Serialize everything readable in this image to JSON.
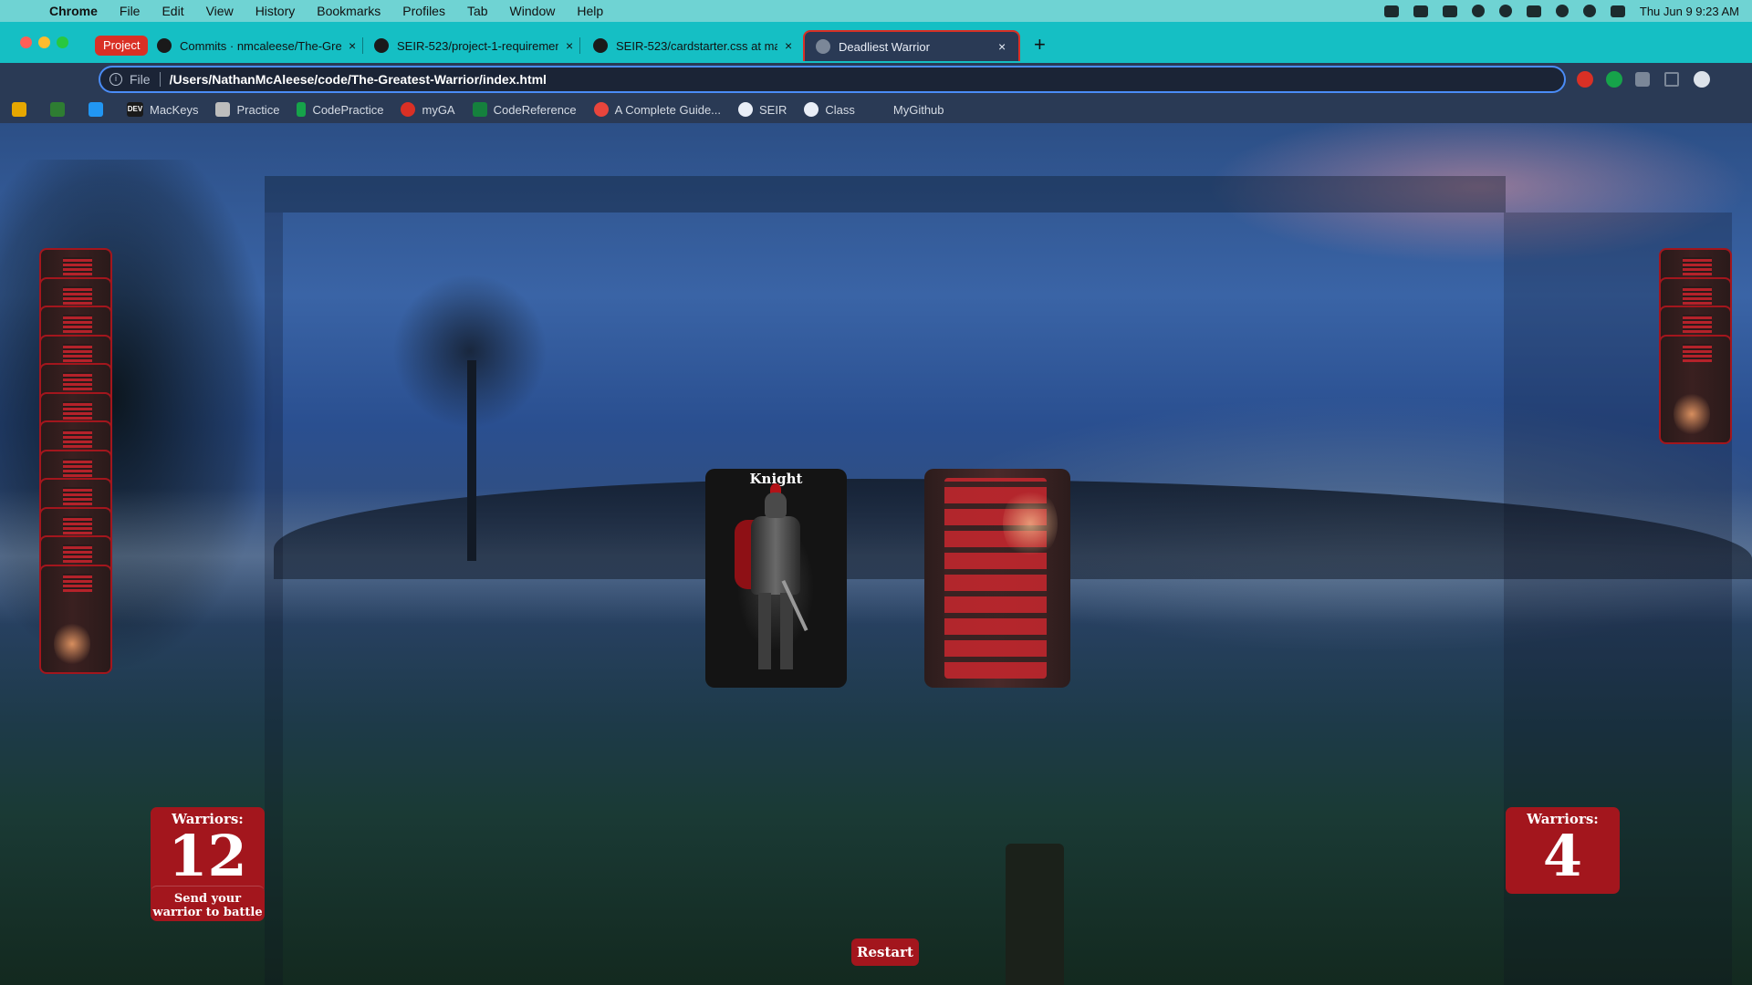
{
  "menubar": {
    "app": "Chrome",
    "items": [
      "File",
      "Edit",
      "View",
      "History",
      "Bookmarks",
      "Profiles",
      "Tab",
      "Window",
      "Help"
    ],
    "datetime": "Thu Jun 9  9:23 AM"
  },
  "tabs": {
    "group_label": "Project",
    "items": [
      {
        "title": "Commits · nmcaleese/The-Gre"
      },
      {
        "title": "SEIR-523/project-1-requiremen"
      },
      {
        "title": "SEIR-523/cardstarter.css at ma"
      },
      {
        "title": "Deadliest Warrior"
      }
    ],
    "close_glyph": "×",
    "new_tab_glyph": "+"
  },
  "toolbar": {
    "scheme": "File",
    "url": "/Users/NathanMcAleese/code/The-Greatest-Warrior/index.html"
  },
  "bookmarks": [
    {
      "label": "",
      "color": "#e6a700"
    },
    {
      "label": "",
      "color": "#2e7d32"
    },
    {
      "label": "",
      "color": "#2196f3"
    },
    {
      "label": "MacKeys",
      "badge": "DEV",
      "color": "#1a1a1a"
    },
    {
      "label": "Practice",
      "color": "#bdbdbd"
    },
    {
      "label": "CodePractice",
      "color": "#16a34a"
    },
    {
      "label": "myGA",
      "color": "#d93025"
    },
    {
      "label": "CodeReference",
      "color": "#15803d"
    },
    {
      "label": "A Complete Guide...",
      "color": "#e8453c"
    },
    {
      "label": "SEIR",
      "color": "#e9eef7"
    },
    {
      "label": "Class",
      "color": "#e9eef7"
    },
    {
      "label": "MyGithub",
      "color": "#2a3a55"
    }
  ],
  "game": {
    "player_card_name": "Knight",
    "left_counter": {
      "label": "Warriors:",
      "count": "12"
    },
    "right_counter": {
      "label": "Warriors:",
      "count": "4"
    },
    "send_button": "Send your warrior to battle",
    "restart_button": "Restart",
    "left_stack_count": 12,
    "right_stack_count": 4,
    "accent_color": "#a3161d"
  }
}
